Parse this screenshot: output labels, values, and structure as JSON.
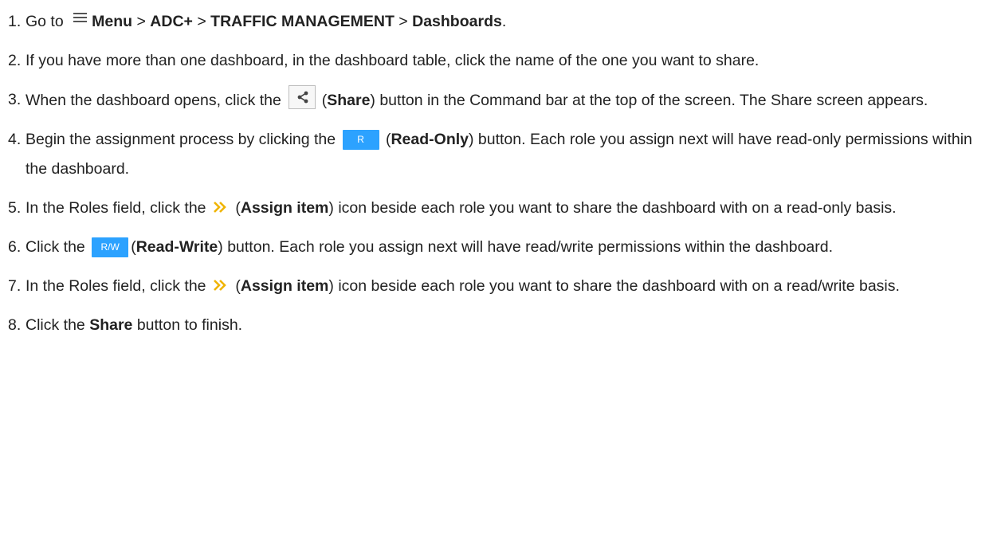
{
  "steps": [
    {
      "num": "1.",
      "t1": "Go to ",
      "menu": "Menu",
      "sep1": " > ",
      "adc": "ADC+",
      "sep2": " > ",
      "traffic": "TRAFFIC MANAGEMENT",
      "sep3": " > ",
      "dashboards": "Dashboards",
      "end": "."
    },
    {
      "num": "2.",
      "text": "If you have more than one dashboard, in the dashboard table, click the name of the one you want to share."
    },
    {
      "num": "3.",
      "t1": "When the dashboard opens, click the ",
      "t2": " (",
      "bold": "Share",
      "t3": ") button in the Command bar at the top of the screen. The Share screen appears."
    },
    {
      "num": "4.",
      "t1": "Begin the assignment process by clicking the ",
      "btn": "R",
      "t2": " (",
      "bold": "Read-Only",
      "t3": ") button. Each role you assign next will have read-only permissions within the dashboard."
    },
    {
      "num": "5.",
      "t1": "In the Roles field, click the ",
      "t2": " (",
      "bold": "Assign item",
      "t3": ") icon beside each role you want to share the dashboard with on a read-only basis."
    },
    {
      "num": "6.",
      "t1": "Click the ",
      "btn": "R/W",
      "t2": "(",
      "bold": "Read-Write",
      "t3": ") button. Each role you assign next will have read/write permissions within the dashboard."
    },
    {
      "num": "7.",
      "t1": "In the Roles field, click the ",
      "t2": " (",
      "bold": "Assign item",
      "t3": ") icon beside each role you want to share the dashboard with on a read/write basis."
    },
    {
      "num": "8.",
      "t1": "Click the ",
      "bold": "Share",
      "t2": " button to finish."
    }
  ],
  "icons": {
    "menu": "hamburger-menu-icon",
    "share": "share-icon",
    "assign": "double-chevron-right-icon"
  },
  "colors": {
    "text": "#222222",
    "button_blue": "#2ca2ff",
    "assign_gold": "#f0b400"
  }
}
